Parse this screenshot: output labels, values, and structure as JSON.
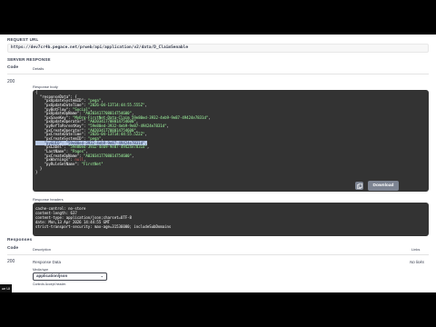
{
  "request_url": {
    "label": "REQUEST URL",
    "value": "https://dev7cr4b.pegace.net/prweb/api/application/v2/data/D_ClaimSenable"
  },
  "server_response": {
    "label": "SERVER RESPONSE",
    "col_code": "Code",
    "col_details": "Details",
    "code": "200",
    "response_body_label": "Response body",
    "json_lines": [
      [
        {
          "t": "{",
          "c": "k"
        }
      ],
      [
        {
          "t": "  \"responseData\": {",
          "c": "k"
        }
      ],
      [
        {
          "t": "    \"pxUpdateSystemID\": ",
          "c": "k"
        },
        {
          "t": "\"pega\"",
          "c": "s"
        },
        {
          "t": ",",
          "c": "k"
        }
      ],
      [
        {
          "t": "    \"pxUpdateDateTime\": ",
          "c": "k"
        },
        {
          "t": "\"2026-04-13T14:44:55.555Z\"",
          "c": "s"
        },
        {
          "t": ",",
          "c": "k"
        }
      ],
      [
        {
          "t": "    \"pyBotFlow\": ",
          "c": "k"
        },
        {
          "t": "\"Social\"",
          "c": "s"
        },
        {
          "t": ",",
          "c": "k"
        }
      ],
      [
        {
          "t": "    \"pxUpdateOpName\": ",
          "c": "k"
        },
        {
          "t": "\"A0203417708014754600\"",
          "c": "s"
        },
        {
          "t": ",",
          "c": "k"
        }
      ],
      [
        {
          "t": "    \"pxSaveKey\": ",
          "c": "k"
        },
        {
          "t": "\"MyOrg-FirstNet-Data-Claim 59e80ed-3932-4eb9-9e87-49424e7831d\"",
          "c": "s"
        },
        {
          "t": ",",
          "c": "k"
        }
      ],
      [
        {
          "t": "    \"pxUpdateOperator\": ",
          "c": "k"
        },
        {
          "t": "\"A0203417708014754600\"",
          "c": "s"
        },
        {
          "t": ",",
          "c": "k"
        }
      ],
      [
        {
          "t": "    \"pyRefToParentKey\": ",
          "c": "k"
        },
        {
          "t": "\"59e80ed-3932-4eb9-9e87-49424e7831d\"",
          "c": "s"
        },
        {
          "t": ",",
          "c": "k"
        }
      ],
      [
        {
          "t": "    \"pxCreateOperator\": ",
          "c": "k"
        },
        {
          "t": "\"A0203417708014754600\"",
          "c": "s"
        },
        {
          "t": ",",
          "c": "k"
        }
      ],
      [
        {
          "t": "    \"pxCreateDateTime\": ",
          "c": "k"
        },
        {
          "t": "\"2026-04-13T14:44:55.522Z\"",
          "c": "s"
        },
        {
          "t": ",",
          "c": "k"
        }
      ],
      [
        {
          "t": "    \"pxCreateSystemID\": ",
          "c": "k"
        },
        {
          "t": "\"pega\"",
          "c": "s"
        },
        {
          "t": ",",
          "c": "k"
        }
      ],
      [
        {
          "t": "    \"pyGUID\": \"59e80ed-3932-4eb9-9e87-49424e7831d\",",
          "c": "hl"
        }
      ],
      [
        {
          "t": "    \"pxLabel\": ",
          "c": "k"
        },
        {
          "t": "\"59e80ed-3932-4eb9-9e87-49424e7831d\"",
          "c": "s"
        },
        {
          "t": ",",
          "c": "k"
        }
      ],
      [
        {
          "t": "    \"LastName\": ",
          "c": "k"
        },
        {
          "t": "\"Pages\"",
          "c": "s"
        },
        {
          "t": ",",
          "c": "k"
        }
      ],
      [
        {
          "t": "    \"pxCreateOpName\": ",
          "c": "k"
        },
        {
          "t": "\"A0203417708014754600\"",
          "c": "s"
        },
        {
          "t": ",",
          "c": "k"
        }
      ],
      [
        {
          "t": "    \"pxWarnings\": ",
          "c": "k"
        },
        {
          "t": "null",
          "c": "n"
        },
        {
          "t": ",",
          "c": "k"
        }
      ],
      [
        {
          "t": "    \"pyRuleSetName\": ",
          "c": "k"
        },
        {
          "t": "\"FirstNet\"",
          "c": "s"
        }
      ],
      [
        {
          "t": "  }",
          "c": "k"
        }
      ],
      [
        {
          "t": "}",
          "c": "k"
        }
      ]
    ],
    "download_label": "Download",
    "response_headers_label": "Response headers",
    "header_lines": [
      "cache-control: no-store",
      "content-length: 637",
      "content-type: application/json;charset=UTF-8",
      "date: Mon,13 Apr 2026 14:44:55 GMT",
      "strict-transport-security: max-age=31536000; includeSubDomains"
    ]
  },
  "responses": {
    "label": "Responses",
    "col_code": "Code",
    "col_description": "Description",
    "col_links": "Links",
    "code": "200",
    "description": "Response Data",
    "links": "No links",
    "media_type_label": "Media type",
    "media_type_value": "application/json",
    "caret": "⌄",
    "accept_note": "Controls Accept header."
  },
  "corner_label": "ue UI",
  "copy_icon": "copy-icon"
}
